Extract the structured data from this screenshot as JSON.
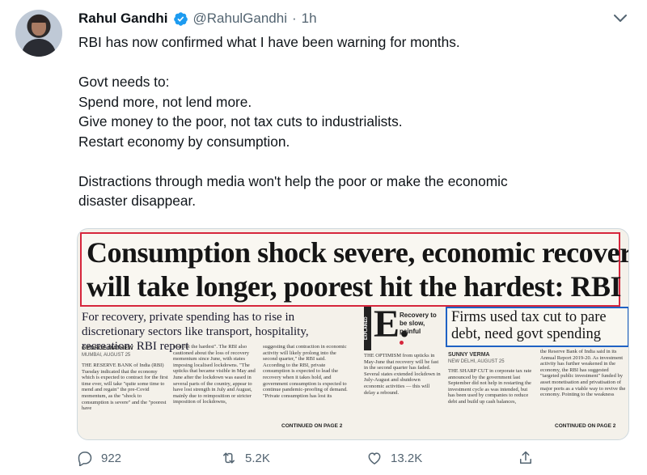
{
  "author": {
    "name": "Rahul Gandhi",
    "handle": "@RahulGandhi",
    "separator": "·",
    "time": "1h"
  },
  "tweet": {
    "line1": "RBI has now confirmed what I have been warning for months.",
    "line2": "Govt needs to:",
    "line3": "Spend more, not lend more.",
    "line4": "Give money to the poor, not tax cuts to industrialists.",
    "line5": "Restart economy by consumption.",
    "line6": "Distractions through media won't help the poor or make the economic",
    "line7": "disaster disappear."
  },
  "clipping": {
    "headline_line1": "Consumption shock severe, economic recovery",
    "headline_line2": "will take longer, poorest hit the hardest: RBI",
    "deck": "For recovery, private spending has to rise in discretionary sectors like transport, hospitality, recreation: RBI report",
    "byline_left": "GEORGE MATHEW",
    "dateline_left": "MUMBAI, AUGUST 25",
    "col1": "THE RESERVE BANK of India (RBI) Tuesday indicated that the economy which is expected to contract for the first time ever, will take \"quite some time to mend and regain\" the pre-Covid momentum, as the \"shock to consumption is severe\" and the \"poorest have",
    "col2": "been hit the hardest\". The RBI also cautioned about the loss of recovery momentum since June, with states imposing localised lockdowns. \"The upticks that became visible in May and June after the lockdown was eased in several parts of the country, appear to have lost strength in July and August, mainly due to reimposition or stricter imposition of lockdowns,",
    "col3": "suggesting that contraction in economic activity will likely prolong into the second quarter,\" the RBI said. According to the RBI, private consumption is expected to lead the recovery when it takes hold, and government consumption is expected to continue pandemic-proofing of demand. \"Private consumption has lost its",
    "continued_left": "CONTINUED ON PAGE 2",
    "explained_tag": "EXPLAINED",
    "explained_letter": "E.",
    "explained_text": "Recovery to be slow, painful",
    "col4": "THE OPTIMISM from upticks in May-June that recovery will be fast in the second quarter has faded. Several states extended lockdown in July-August and shutdown economic activities — this will delay a rebound.",
    "side_headline_line1": "Firms used tax cut to pare",
    "side_headline_line2": "debt, need govt spending",
    "byline_right": "SUNNY VERMA",
    "dateline_right": "NEW DELHI, AUGUST 25",
    "col5": "THE SHARP CUT in corporate tax rate announced by the government last September did not help in restarting the investment cycle as was intended, but has been used by companies to reduce debt and build up cash balances,",
    "col6": "the Reserve Bank of India said in its Annual Report 2019-20. As investment activity has further weakened in the economy, the RBI has suggested \"targeted public investment\" funded by asset monetisation and privatisation of major ports as a viable way to revive the economy. Pointing to the weakness",
    "continued_right": "CONTINUED ON PAGE 2"
  },
  "actions": {
    "replies": "922",
    "retweets": "5.2K",
    "likes": "13.2K"
  },
  "icons": {
    "verified": "verified-badge-icon",
    "more": "more-icon",
    "reply": "reply-icon",
    "retweet": "retweet-icon",
    "like": "like-icon",
    "share": "share-icon"
  },
  "colors": {
    "verified": "#1d9bf0",
    "muted": "#536471",
    "headline_box": "#d6263c",
    "side_box": "#1f62c4"
  }
}
